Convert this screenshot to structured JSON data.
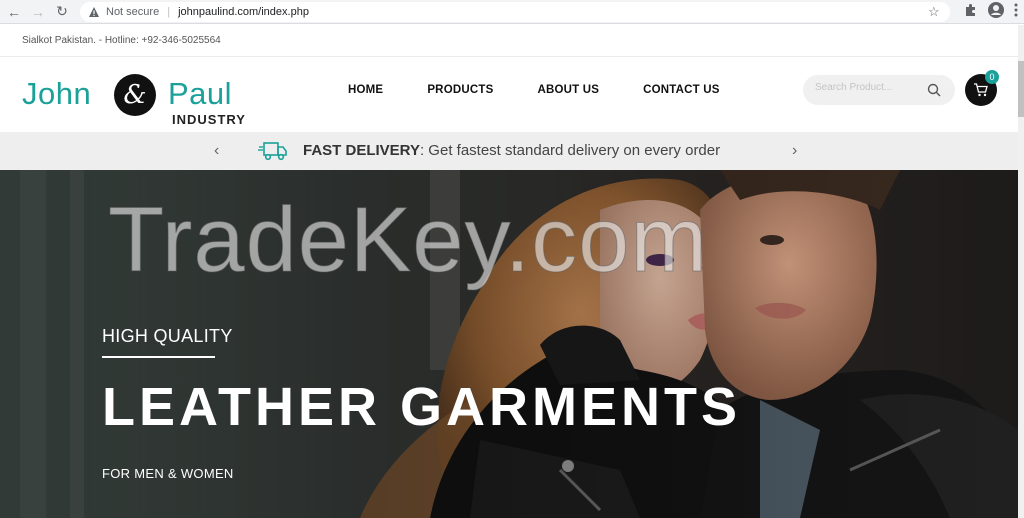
{
  "browser": {
    "security_label": "Not secure",
    "url": "johnpaulind.com/index.php"
  },
  "topbar": {
    "text": "Sialkot Pakistan. - Hotline: +92-346-5025564"
  },
  "logo": {
    "word1": "John",
    "amp": "&",
    "word2": "Paul",
    "tagline": "INDUSTRY"
  },
  "menu": {
    "items": [
      {
        "label": "HOME"
      },
      {
        "label": "PRODUCTS"
      },
      {
        "label": "ABOUT US"
      },
      {
        "label": "CONTACT US"
      }
    ]
  },
  "search": {
    "placeholder": "Search Product..."
  },
  "cart": {
    "count": "0"
  },
  "delivery": {
    "bold": "FAST DELIVERY",
    "text": ": Get fastest standard delivery on every order"
  },
  "hero": {
    "eyebrow": "HIGH QUALITY",
    "title": "LEATHER GARMENTS",
    "subtitle": "FOR MEN & WOMEN",
    "watermark": "TradeKey.com"
  },
  "colors": {
    "brand": "#1ba19a",
    "dark": "#111111"
  }
}
